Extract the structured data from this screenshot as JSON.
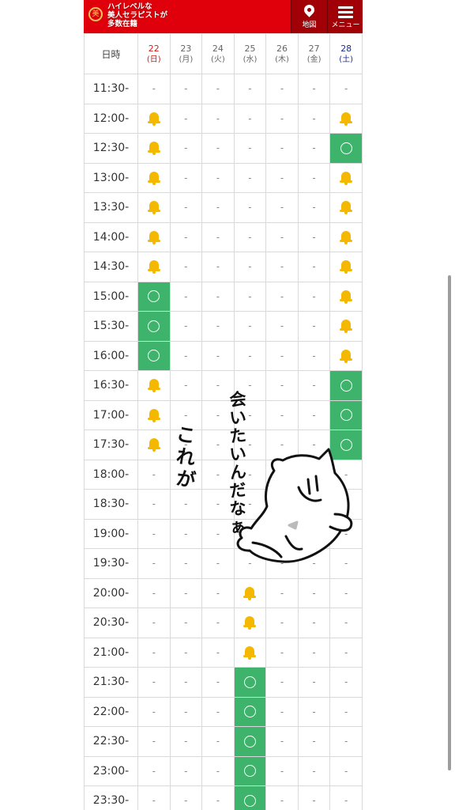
{
  "header": {
    "logo_text": "ハイレベルな\n美人セラピストが\n多数在籍",
    "logo_mark": "美",
    "map_label": "地図",
    "menu_label": "メニュー"
  },
  "schedule": {
    "corner_label": "日時",
    "days": [
      {
        "num": "22",
        "wk": "(日)",
        "type": "sun"
      },
      {
        "num": "23",
        "wk": "(月)",
        "type": ""
      },
      {
        "num": "24",
        "wk": "(火)",
        "type": ""
      },
      {
        "num": "25",
        "wk": "(水)",
        "type": ""
      },
      {
        "num": "26",
        "wk": "(木)",
        "type": ""
      },
      {
        "num": "27",
        "wk": "(金)",
        "type": ""
      },
      {
        "num": "28",
        "wk": "(土)",
        "type": "sat"
      }
    ],
    "rows": [
      {
        "time": "11:30-",
        "cells": [
          "-",
          "-",
          "-",
          "-",
          "-",
          "-",
          "-"
        ]
      },
      {
        "time": "12:00-",
        "cells": [
          "bell",
          "-",
          "-",
          "-",
          "-",
          "-",
          "bell"
        ]
      },
      {
        "time": "12:30-",
        "cells": [
          "bell",
          "-",
          "-",
          "-",
          "-",
          "-",
          "open"
        ]
      },
      {
        "time": "13:00-",
        "cells": [
          "bell",
          "-",
          "-",
          "-",
          "-",
          "-",
          "bell"
        ]
      },
      {
        "time": "13:30-",
        "cells": [
          "bell",
          "-",
          "-",
          "-",
          "-",
          "-",
          "bell"
        ]
      },
      {
        "time": "14:00-",
        "cells": [
          "bell",
          "-",
          "-",
          "-",
          "-",
          "-",
          "bell"
        ]
      },
      {
        "time": "14:30-",
        "cells": [
          "bell",
          "-",
          "-",
          "-",
          "-",
          "-",
          "bell"
        ]
      },
      {
        "time": "15:00-",
        "cells": [
          "open",
          "-",
          "-",
          "-",
          "-",
          "-",
          "bell"
        ]
      },
      {
        "time": "15:30-",
        "cells": [
          "open",
          "-",
          "-",
          "-",
          "-",
          "-",
          "bell"
        ]
      },
      {
        "time": "16:00-",
        "cells": [
          "open",
          "-",
          "-",
          "-",
          "-",
          "-",
          "bell"
        ]
      },
      {
        "time": "16:30-",
        "cells": [
          "bell",
          "-",
          "-",
          "-",
          "-",
          "-",
          "open"
        ]
      },
      {
        "time": "17:00-",
        "cells": [
          "bell",
          "-",
          "-",
          "-",
          "-",
          "-",
          "open"
        ]
      },
      {
        "time": "17:30-",
        "cells": [
          "bell",
          "-",
          "-",
          "-",
          "-",
          "-",
          "open"
        ]
      },
      {
        "time": "18:00-",
        "cells": [
          "-",
          "-",
          "-",
          "-",
          "-",
          "-",
          "-"
        ]
      },
      {
        "time": "18:30-",
        "cells": [
          "-",
          "-",
          "-",
          "-",
          "-",
          "-",
          "-"
        ]
      },
      {
        "time": "19:00-",
        "cells": [
          "-",
          "-",
          "-",
          "-",
          "-",
          "-",
          "-"
        ]
      },
      {
        "time": "19:30-",
        "cells": [
          "-",
          "-",
          "-",
          "-",
          "-",
          "-",
          "-"
        ]
      },
      {
        "time": "20:00-",
        "cells": [
          "-",
          "-",
          "-",
          "bell",
          "-",
          "-",
          "-"
        ]
      },
      {
        "time": "20:30-",
        "cells": [
          "-",
          "-",
          "-",
          "bell",
          "-",
          "-",
          "-"
        ]
      },
      {
        "time": "21:00-",
        "cells": [
          "-",
          "-",
          "-",
          "bell",
          "-",
          "-",
          "-"
        ]
      },
      {
        "time": "21:30-",
        "cells": [
          "-",
          "-",
          "-",
          "open",
          "-",
          "-",
          "-"
        ]
      },
      {
        "time": "22:00-",
        "cells": [
          "-",
          "-",
          "-",
          "open",
          "-",
          "-",
          "-"
        ]
      },
      {
        "time": "22:30-",
        "cells": [
          "-",
          "-",
          "-",
          "open",
          "-",
          "-",
          "-"
        ]
      },
      {
        "time": "23:00-",
        "cells": [
          "-",
          "-",
          "-",
          "open",
          "-",
          "-",
          "-"
        ]
      },
      {
        "time": "23:30-",
        "cells": [
          "-",
          "-",
          "-",
          "open",
          "-",
          "-",
          "-"
        ]
      }
    ]
  },
  "sticker": {
    "text_left": "これが",
    "text_right": "会いたいんだなぁ"
  },
  "colors": {
    "header_red": "#e0000b",
    "button_dark_red": "#a20007",
    "open_green": "#3db36b",
    "bell_yellow": "#f5b800",
    "sunday_red": "#d21a1a",
    "saturday_blue": "#1c2e8c"
  },
  "legend_icons": {
    "open": "circle-icon",
    "call": "bell-icon",
    "closed": "dash"
  }
}
